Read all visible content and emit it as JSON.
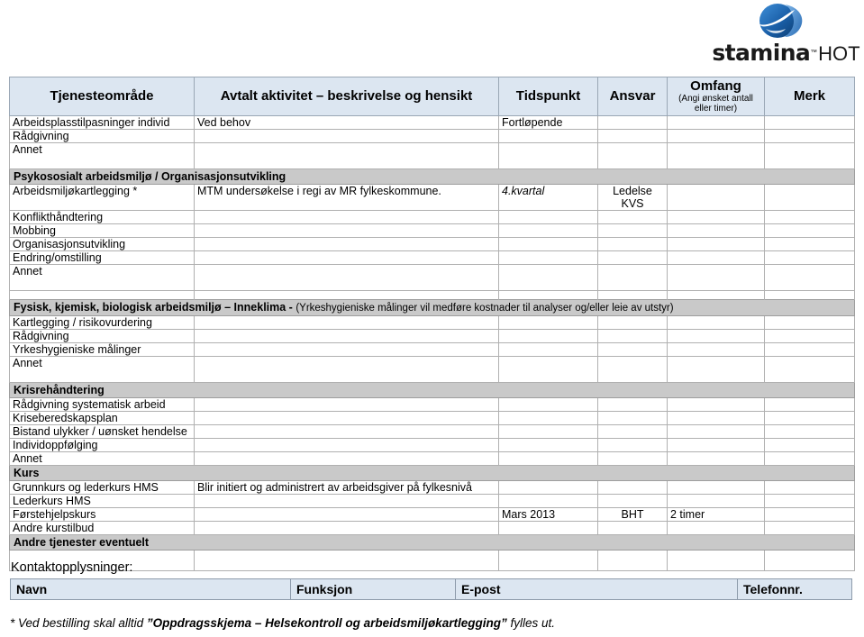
{
  "logo": {
    "mark_icon": "stamina-sphere-icon",
    "wordmark_main": "stamina",
    "wordmark_tm": "™",
    "wordmark_suffix": "HOT",
    "brand_color": "#1a6fc4"
  },
  "table": {
    "headers": {
      "tjenesteomrade": "Tjenesteområde",
      "aktivitet": "Avtalt aktivitet – beskrivelse og hensikt",
      "tidspunkt": "Tidspunkt",
      "ansvar": "Ansvar",
      "omfang": "Omfang",
      "omfang_sub": "(Angi ønsket antall eller timer)",
      "merk": "Merk"
    },
    "rows": [
      {
        "kind": "data",
        "tjeneste": "Arbeidsplasstilpasninger individ",
        "aktivitet": "Ved behov",
        "tidspunkt": "Fortløpende",
        "ansvar": "",
        "omfang": "",
        "merk": ""
      },
      {
        "kind": "data",
        "tjeneste": "Rådgivning",
        "aktivitet": "",
        "tidspunkt": "",
        "ansvar": "",
        "omfang": "",
        "merk": ""
      },
      {
        "kind": "data",
        "tjeneste": "Annet",
        "aktivitet": "",
        "tidspunkt": "",
        "ansvar": "",
        "omfang": "",
        "merk": "",
        "tall": true
      },
      {
        "kind": "section",
        "title": "Psykososialt arbeidsmiljø / Organisasjonsutvikling",
        "note": ""
      },
      {
        "kind": "data",
        "tjeneste": "Arbeidsmiljøkartlegging *",
        "aktivitet": "MTM undersøkelse i regi av MR fylkeskommune.",
        "tidspunkt": "4.kvartal",
        "tidspunkt_italic": true,
        "ansvar": "Ledelse\nKVS",
        "ansvar_center": true,
        "omfang": "",
        "merk": "",
        "tall": true
      },
      {
        "kind": "data",
        "tjeneste": "Konflikthåndtering",
        "aktivitet": "",
        "tidspunkt": "",
        "ansvar": "",
        "omfang": "",
        "merk": ""
      },
      {
        "kind": "data",
        "tjeneste": "Mobbing",
        "aktivitet": "",
        "tidspunkt": "",
        "ansvar": "",
        "omfang": "",
        "merk": ""
      },
      {
        "kind": "data",
        "tjeneste": "Organisasjonsutvikling",
        "aktivitet": "",
        "tidspunkt": "",
        "ansvar": "",
        "omfang": "",
        "merk": ""
      },
      {
        "kind": "data",
        "tjeneste": "Endring/omstilling",
        "aktivitet": "",
        "tidspunkt": "",
        "ansvar": "",
        "omfang": "",
        "merk": ""
      },
      {
        "kind": "data",
        "tjeneste": "Annet",
        "aktivitet": "",
        "tidspunkt": "",
        "ansvar": "",
        "omfang": "",
        "merk": "",
        "tall": true
      },
      {
        "kind": "spacer"
      },
      {
        "kind": "section",
        "title": "Fysisk, kjemisk, biologisk arbeidsmiljø – Inneklima - ",
        "note": "(Yrkeshygieniske målinger vil medføre kostnader til analyser og/eller leie av utstyr)"
      },
      {
        "kind": "data",
        "tjeneste": "Kartlegging / risikovurdering",
        "aktivitet": "",
        "tidspunkt": "",
        "ansvar": "",
        "omfang": "",
        "merk": ""
      },
      {
        "kind": "data",
        "tjeneste": "Rådgivning",
        "aktivitet": "",
        "tidspunkt": "",
        "ansvar": "",
        "omfang": "",
        "merk": ""
      },
      {
        "kind": "data",
        "tjeneste": "Yrkeshygieniske målinger",
        "aktivitet": "",
        "tidspunkt": "",
        "ansvar": "",
        "omfang": "",
        "merk": ""
      },
      {
        "kind": "data",
        "tjeneste": "Annet",
        "aktivitet": "",
        "tidspunkt": "",
        "ansvar": "",
        "omfang": "",
        "merk": "",
        "tall": true
      },
      {
        "kind": "section",
        "title": "Krisrehåndtering",
        "note": ""
      },
      {
        "kind": "data",
        "tjeneste": "Rådgivning systematisk arbeid",
        "aktivitet": "",
        "tidspunkt": "",
        "ansvar": "",
        "omfang": "",
        "merk": ""
      },
      {
        "kind": "data",
        "tjeneste": "Kriseberedskapsplan",
        "aktivitet": "",
        "tidspunkt": "",
        "ansvar": "",
        "omfang": "",
        "merk": ""
      },
      {
        "kind": "data",
        "tjeneste": "Bistand ulykker / uønsket hendelse",
        "aktivitet": "",
        "tidspunkt": "",
        "ansvar": "",
        "omfang": "",
        "merk": ""
      },
      {
        "kind": "data",
        "tjeneste": "Individoppfølging",
        "aktivitet": "",
        "tidspunkt": "",
        "ansvar": "",
        "omfang": "",
        "merk": ""
      },
      {
        "kind": "data",
        "tjeneste": "Annet",
        "aktivitet": "",
        "tidspunkt": "",
        "ansvar": "",
        "omfang": "",
        "merk": ""
      },
      {
        "kind": "section",
        "title": "Kurs",
        "note": ""
      },
      {
        "kind": "data",
        "tjeneste": "Grunnkurs og lederkurs HMS",
        "aktivitet": "Blir initiert og administrert av arbeidsgiver på fylkesnivå",
        "tidspunkt": "",
        "ansvar": "",
        "omfang": "",
        "merk": ""
      },
      {
        "kind": "data",
        "tjeneste": "Lederkurs HMS",
        "aktivitet": "",
        "tidspunkt": "",
        "ansvar": "",
        "omfang": "",
        "merk": ""
      },
      {
        "kind": "data",
        "tjeneste": "Førstehjelpskurs",
        "aktivitet": "",
        "tidspunkt": "Mars 2013",
        "ansvar": "BHT",
        "ansvar_center": true,
        "omfang": "2 timer",
        "merk": ""
      },
      {
        "kind": "data",
        "tjeneste": "Andre kurstilbud",
        "aktivitet": "",
        "tidspunkt": "",
        "ansvar": "",
        "omfang": "",
        "merk": ""
      },
      {
        "kind": "section",
        "title": "Andre tjenester eventuelt",
        "note": ""
      },
      {
        "kind": "data",
        "tjeneste": "",
        "aktivitet": "",
        "tidspunkt": "",
        "ansvar": "",
        "omfang": "",
        "merk": "",
        "tall2": true
      }
    ]
  },
  "contact": {
    "label": "Kontaktopplysninger:",
    "headers": [
      "Navn",
      "Funksjon",
      "E-post",
      "Telefonnr."
    ]
  },
  "footnote": {
    "star": "* ",
    "pre": "Ved bestilling skal alltid ",
    "bold": "”Oppdragsskjema – Helsekontroll og arbeidsmiljøkartlegging”",
    "post": " fylles ut."
  }
}
